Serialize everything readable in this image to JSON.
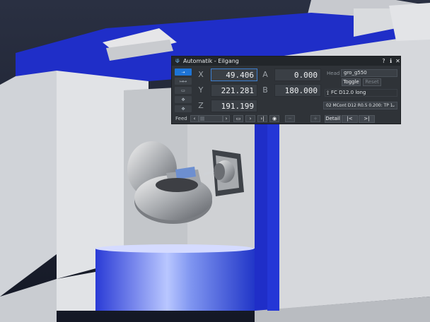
{
  "window": {
    "title": "Automatik - Eilgang",
    "buttons": [
      "?",
      "ℹ",
      "✕"
    ]
  },
  "axes": {
    "x": {
      "label": "X",
      "value": "49.406"
    },
    "y": {
      "label": "Y",
      "value": "221.281"
    },
    "z": {
      "label": "Z",
      "value": "191.199"
    },
    "a": {
      "label": "A",
      "value": "0.000"
    },
    "b": {
      "label": "B",
      "value": "180.000"
    }
  },
  "head": {
    "label": "Head",
    "value": "gro_g550",
    "toggle_label": "Toggle",
    "reset_label": "Reset",
    "tool": "FC D12.0 long",
    "operation": "02 MCont D12 R0.5  0.200: TP 1"
  },
  "feed": {
    "label": "Feed"
  },
  "playback": {
    "detail_label": "Detail",
    "prev_label": "|<",
    "next_label": ">|"
  },
  "colors": {
    "accent": "#1e74d6",
    "machine_blue": "#1f2ec8",
    "machine_gray": "#d4d6da",
    "background": "#1b2030"
  }
}
